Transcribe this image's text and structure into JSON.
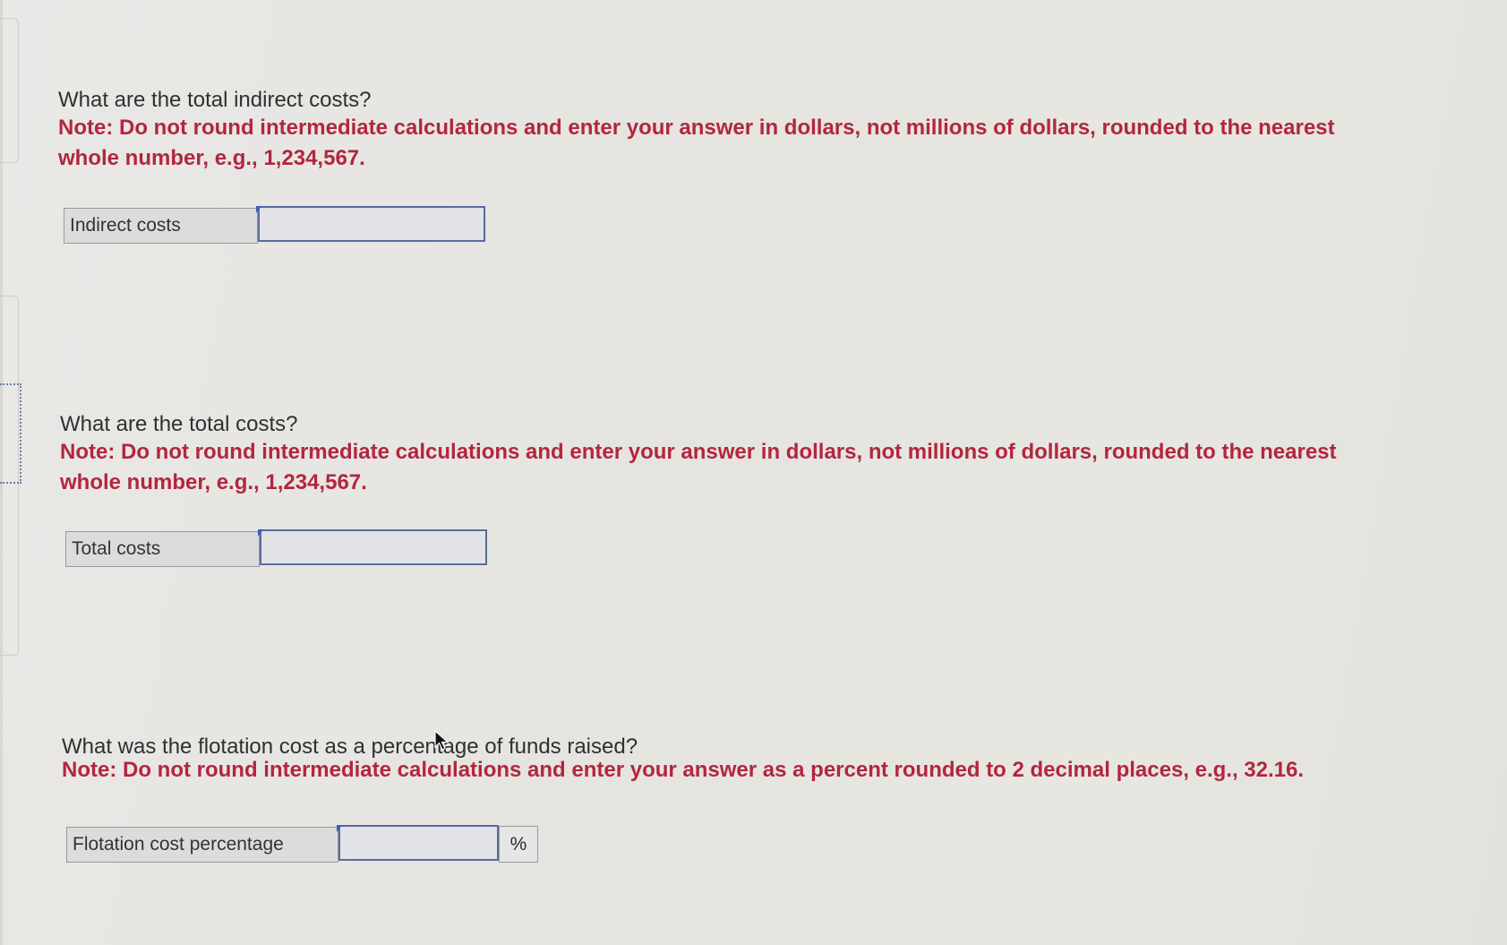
{
  "questions": [
    {
      "question": "What are the total indirect costs?",
      "note_line1": "Note: Do not round intermediate calculations and enter your answer in dollars, not millions of dollars, rounded to the nearest",
      "note_line2": "whole number, e.g., 1,234,567.",
      "field_label": "Indirect costs",
      "input_value": ""
    },
    {
      "question": "What are the total costs?",
      "note_line1": "Note: Do not round intermediate calculations and enter your answer in dollars, not millions of dollars, rounded to the nearest",
      "note_line2": "whole number, e.g., 1,234,567.",
      "field_label": "Total costs",
      "input_value": ""
    },
    {
      "question": "What was the flotation cost as a percentage of funds raised?",
      "note_line1": "Note: Do not round intermediate calculations and enter your answer as a percent rounded to 2 decimal places, e.g., 32.16.",
      "field_label": "Flotation cost percentage",
      "input_value": "",
      "unit": "%"
    }
  ],
  "colors": {
    "note_text": "#b2263f",
    "input_border": "#5a6b9c",
    "label_background": "#dcdcdc"
  },
  "icons": {
    "cursor": "mouse-pointer-icon",
    "input_flag": "input-corner-flag-icon"
  }
}
